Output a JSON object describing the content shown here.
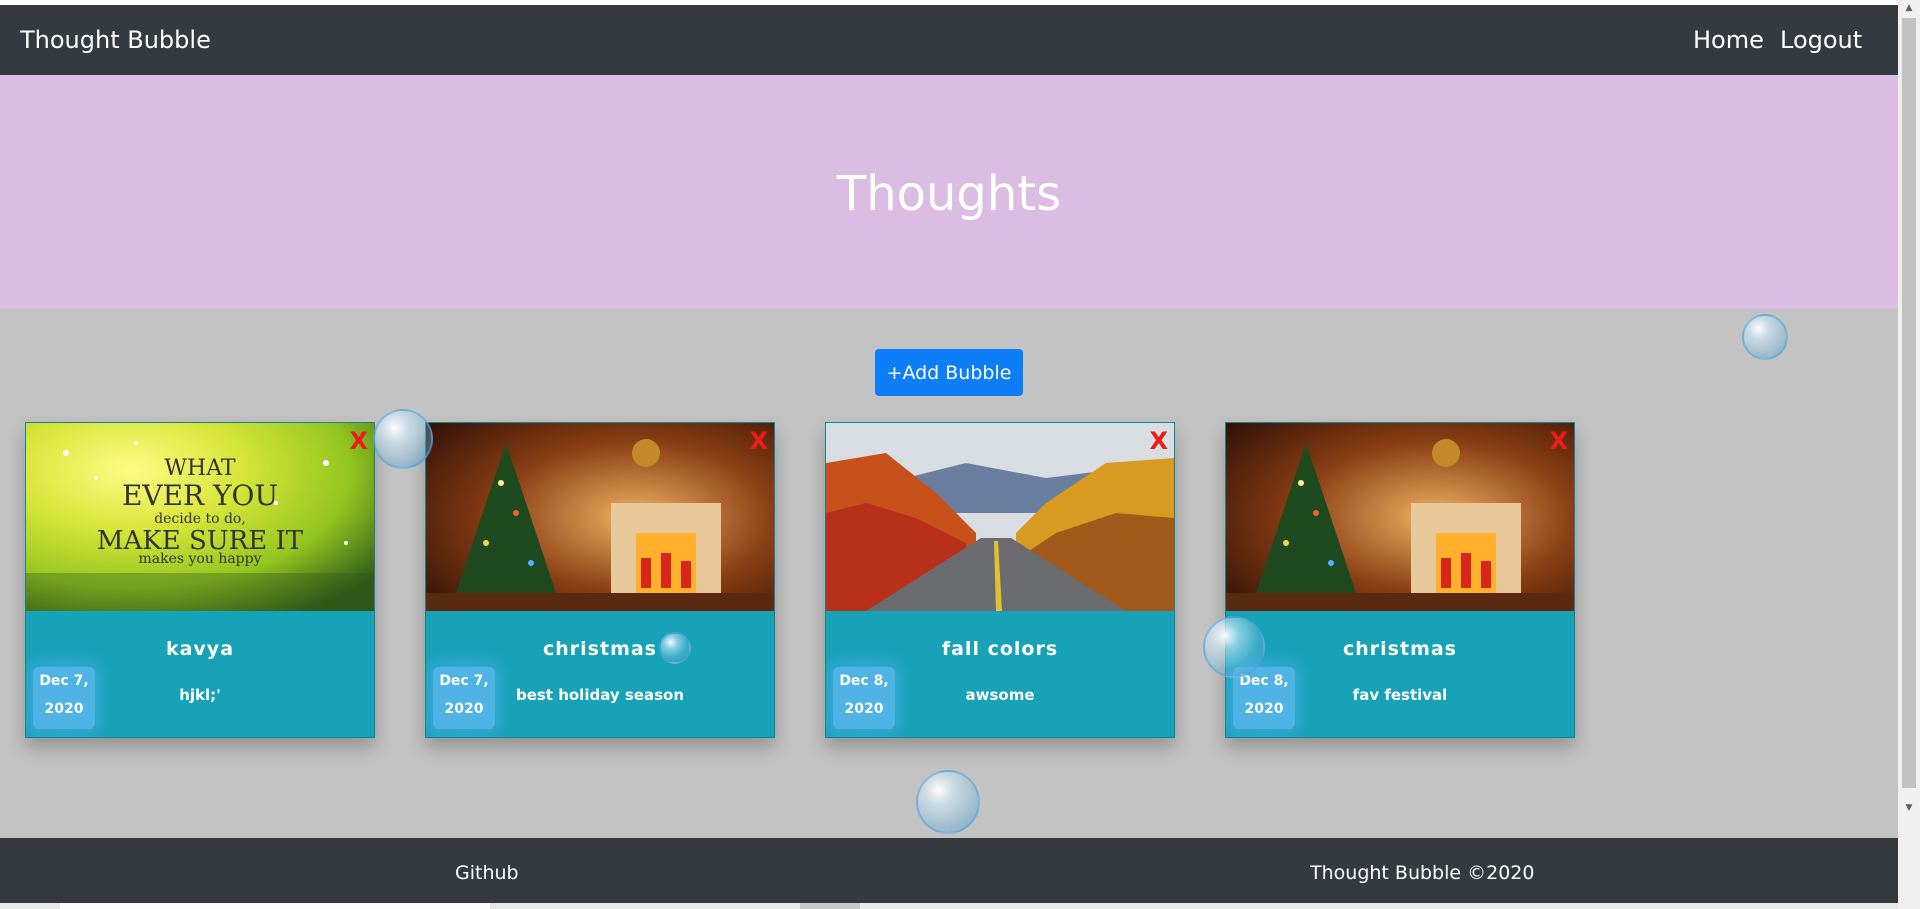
{
  "navbar": {
    "brand": "Thought Bubble",
    "links": [
      "Home",
      "Logout"
    ]
  },
  "hero": {
    "title": "Thoughts"
  },
  "add_button": {
    "label": "+Add Bubble"
  },
  "cards": [
    {
      "image": "what-ever-you-decide-image",
      "title": "kavya",
      "text": "hjkl;'",
      "date_line1": "Dec 7,",
      "date_line2": "2020",
      "close": "X"
    },
    {
      "image": "christmas-fireplace-image",
      "title": "christmas",
      "text": "best holiday season",
      "date_line1": "Dec 7,",
      "date_line2": "2020",
      "close": "X"
    },
    {
      "image": "autumn-road-image",
      "title": "fall colors",
      "text": "awsome",
      "date_line1": "Dec 8,",
      "date_line2": "2020",
      "close": "X"
    },
    {
      "image": "christmas-fireplace-image",
      "title": "christmas",
      "text": "fav festival",
      "date_line1": "Dec 8,",
      "date_line2": "2020",
      "close": "X"
    }
  ],
  "footer": {
    "link": "Github",
    "copyright": "Thought Bubble ©2020"
  },
  "colors": {
    "navbar": "#343a40",
    "hero": "#dbbce3",
    "page_bg": "#c3c3c3",
    "card": "#17a2b8",
    "button": "#0d7df8",
    "close": "#ee1b1b"
  }
}
